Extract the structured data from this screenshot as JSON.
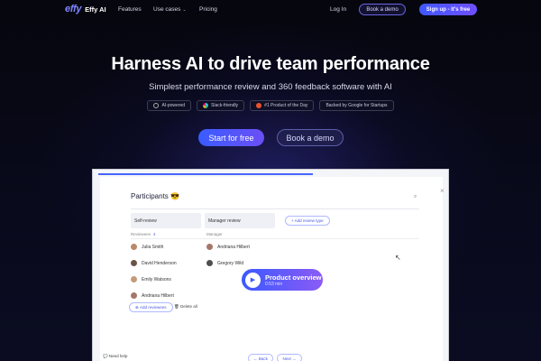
{
  "nav": {
    "logo_mark": "effy",
    "logo_text": "Effy AI",
    "features": "Features",
    "use_cases": "Use cases",
    "pricing": "Pricing",
    "login": "Log In",
    "book_demo": "Book a demo",
    "signup": "Sign up - it's free"
  },
  "hero": {
    "title": "Harness AI to drive team performance",
    "subtitle": "Simplest performance review and 360 feedback software with AI",
    "badges": [
      "AI-powered",
      "Slack-friendly",
      "#1 Product of the Day",
      "Backed by Google for Startups"
    ],
    "cta_primary": "Start for free",
    "cta_secondary": "Book a demo"
  },
  "app": {
    "title": "Participants 😎",
    "col_self": "Self-review",
    "col_manager": "Manager review",
    "add_review_type": "+ Add review type",
    "reviewees_label": "Reviewees",
    "reviewees_count": "4",
    "manager_label": "Manager",
    "reviewees": [
      "Julia Smith",
      "David Henderson",
      "Emily Watsons",
      "Andriana Hilbert"
    ],
    "managers": [
      "Andriana Hilbert",
      "Gregory Wild"
    ],
    "video_title": "Product overview",
    "video_time": "0:53 min",
    "add_reviewees": "Add reviewees",
    "delete_all": "Delete all",
    "need_help": "Need help",
    "back": "Back",
    "next": "Next"
  },
  "colors": {
    "accent": "#4766ff",
    "accent_purple": "#6f4fff",
    "background": "#050510"
  }
}
